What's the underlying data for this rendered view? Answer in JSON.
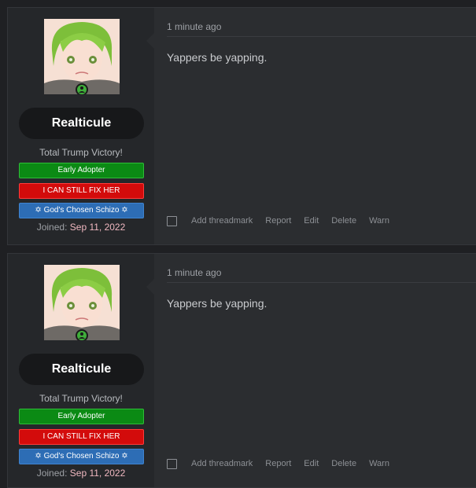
{
  "posts": [
    {
      "username": "Realticule",
      "user_title": "Total Trump Victory!",
      "banners": {
        "early": "Early Adopter",
        "fix": "I CAN STILL FIX HER",
        "chosen": "✡ God's Chosen Schizo ✡"
      },
      "joined_label": "Joined:",
      "joined_date": "Sep 11, 2022",
      "time": "1 minute ago",
      "message": "Yappers be yapping.",
      "actions": {
        "threadmark": "Add threadmark",
        "report": "Report",
        "edit": "Edit",
        "delete": "Delete",
        "warn": "Warn"
      }
    },
    {
      "username": "Realticule",
      "user_title": "Total Trump Victory!",
      "banners": {
        "early": "Early Adopter",
        "fix": "I CAN STILL FIX HER",
        "chosen": "✡ God's Chosen Schizo ✡"
      },
      "joined_label": "Joined:",
      "joined_date": "Sep 11, 2022",
      "time": "1 minute ago",
      "message": "Yappers be yapping.",
      "actions": {
        "threadmark": "Add threadmark",
        "report": "Report",
        "edit": "Edit",
        "delete": "Delete",
        "warn": "Warn"
      }
    }
  ],
  "colors": {
    "banner_green": "#0b8a14",
    "banner_red": "#d30b0b",
    "banner_blue": "#2d6db5",
    "joined_date": "#f0b8c0"
  }
}
